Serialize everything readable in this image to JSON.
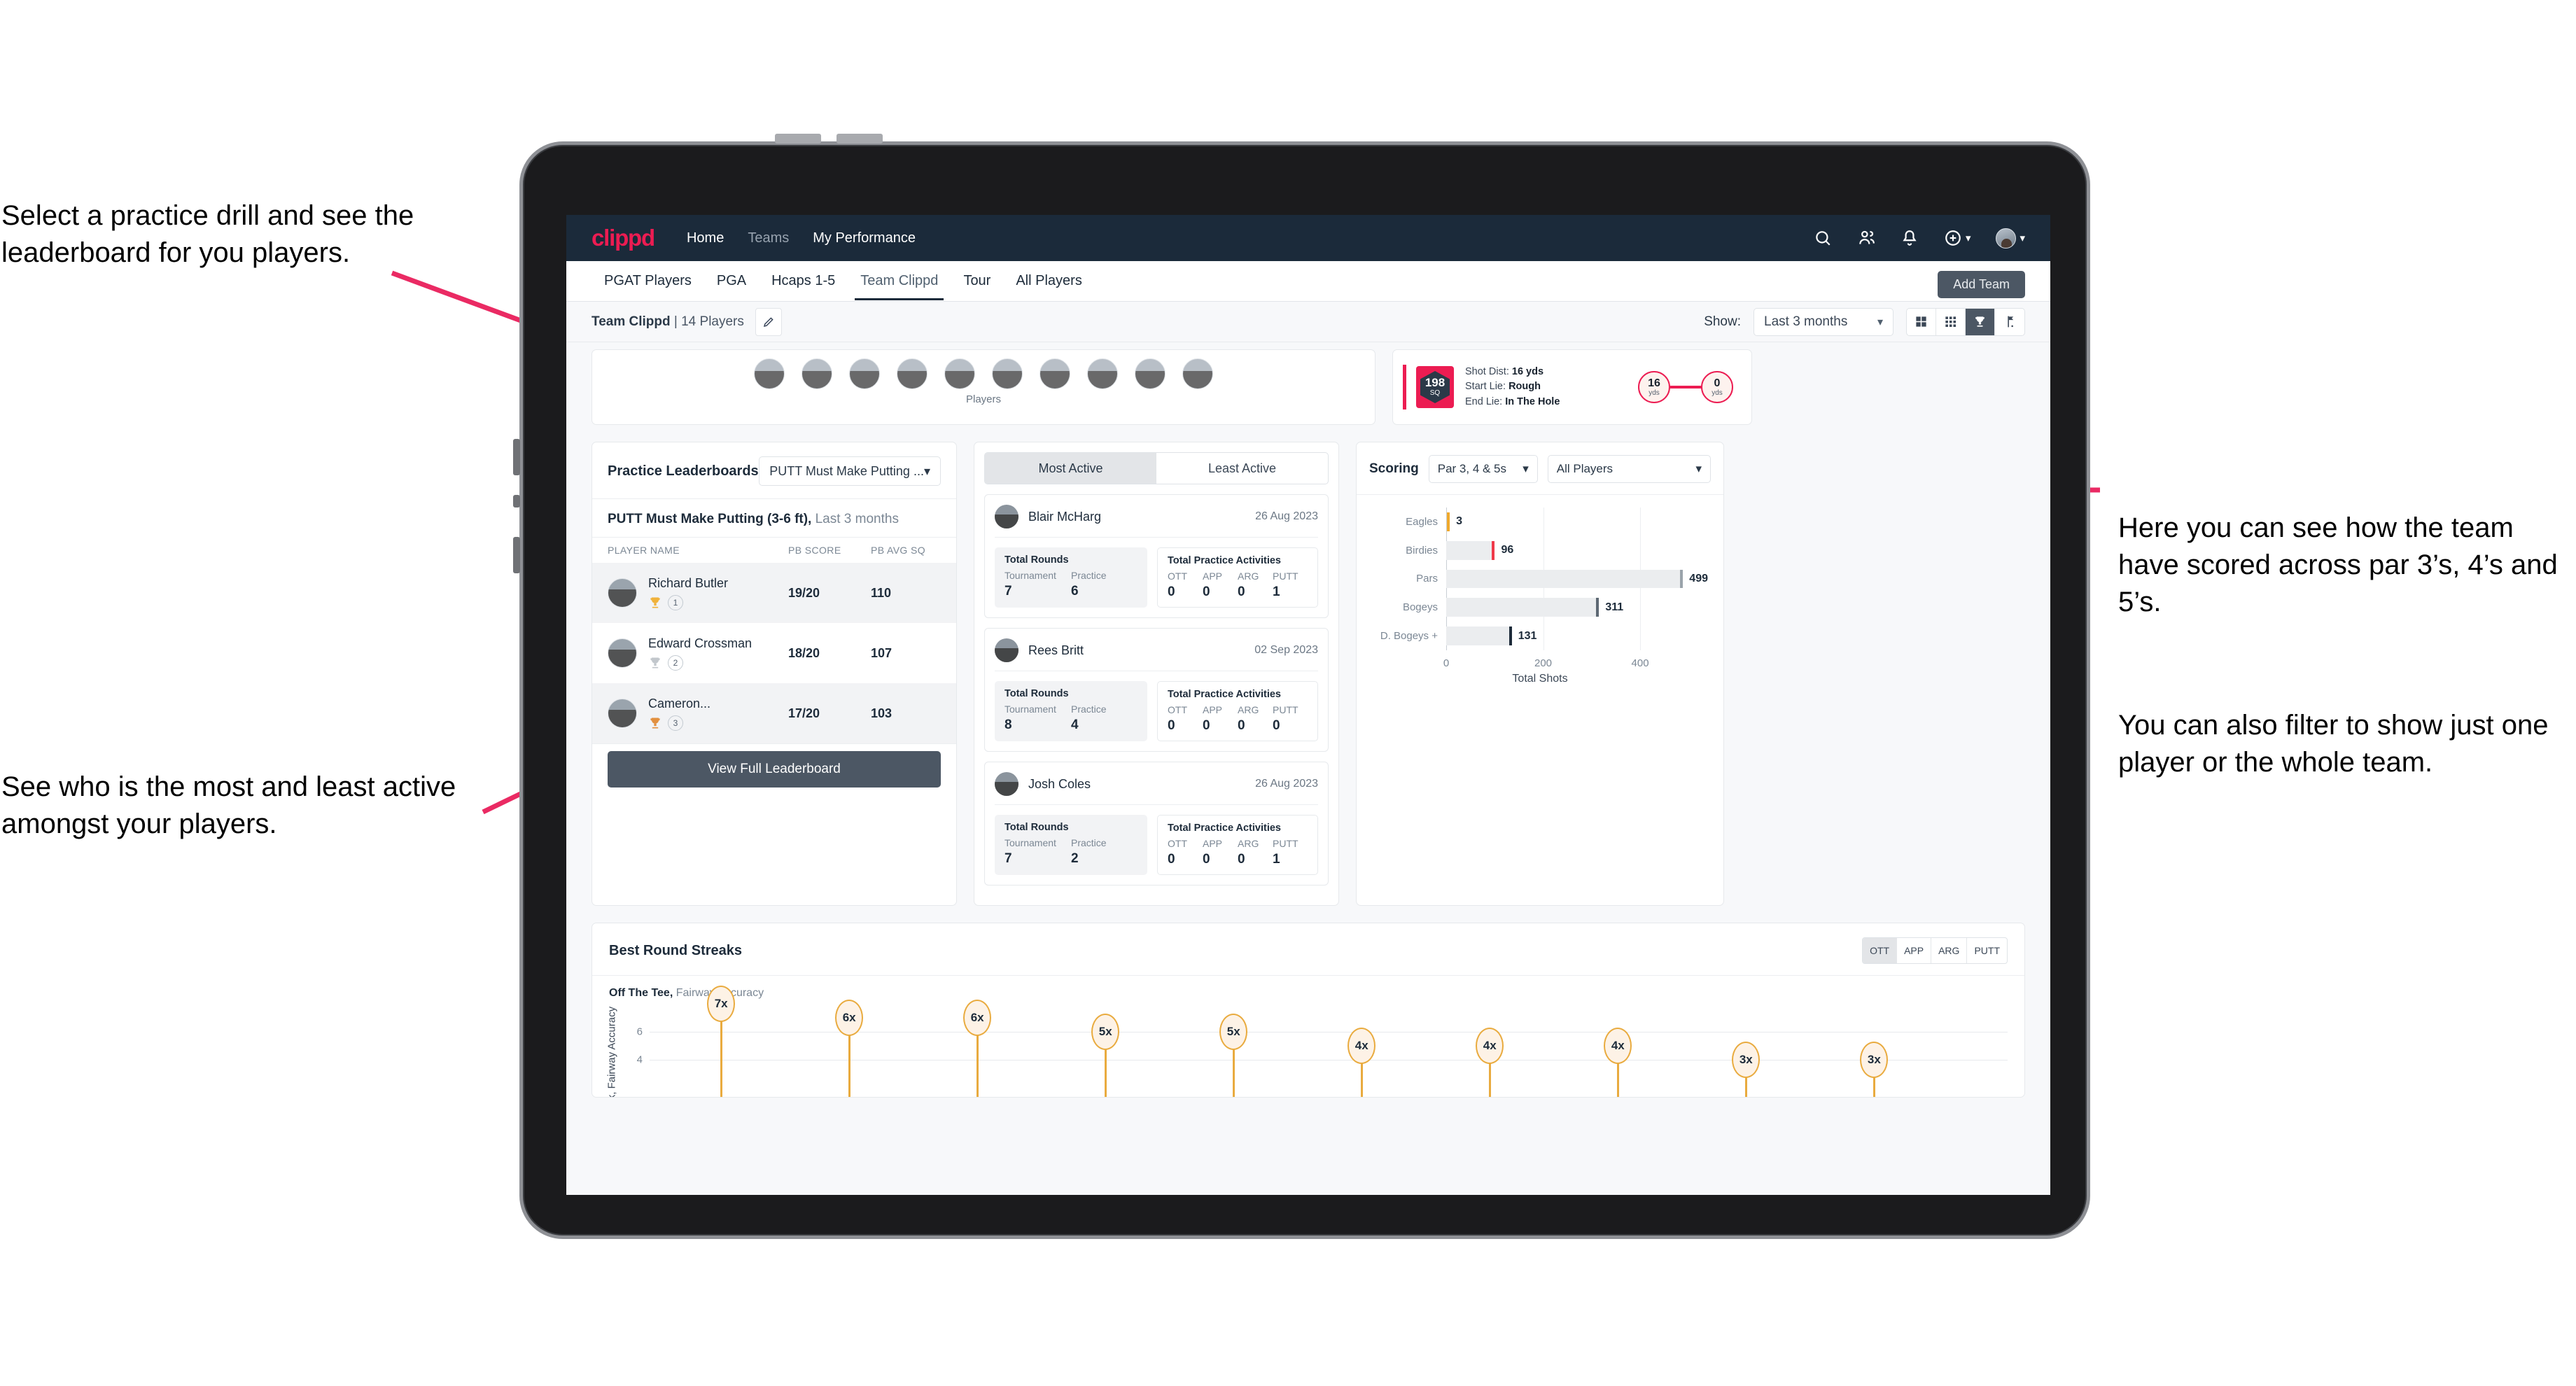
{
  "annotations": {
    "a": "Select a practice drill and see the leaderboard for you players.",
    "b": "See who is the most and least active amongst your players.",
    "c": "Here you can see how the team have scored across par 3’s, 4’s and 5’s.",
    "d": "You can also filter to show just one player or the whole team."
  },
  "colors": {
    "brand_pink": "#ec1c52",
    "nav_dark": "#1b2a3a",
    "button_slate": "#4c5764",
    "gold": "#e9ab3f",
    "bar_grey": "#ebedef"
  },
  "topnav": {
    "logo": "clippd",
    "links": [
      {
        "label": "Home",
        "active": true
      },
      {
        "label": "Teams",
        "active": false
      },
      {
        "label": "My Performance",
        "active": true
      }
    ],
    "icons": [
      "search-icon",
      "people-icon",
      "notification-bell-icon",
      "add-circle-icon",
      "avatar"
    ]
  },
  "tabs": [
    {
      "label": "PGAT Players",
      "state": "normal"
    },
    {
      "label": "PGA",
      "state": "normal"
    },
    {
      "label": "Hcaps 1-5",
      "state": "normal"
    },
    {
      "label": "Team Clippd",
      "state": "active"
    },
    {
      "label": "Tour",
      "state": "normal"
    },
    {
      "label": "All Players",
      "state": "normal"
    }
  ],
  "add_team_button": "Add Team",
  "subheader": {
    "team_label_bold": "Team Clippd",
    "team_label_rest": " | 14 Players",
    "show_label": "Show:",
    "range_value": "Last 3 months",
    "view_buttons": [
      "grid-large-icon",
      "grid-small-icon",
      "trophy-icon",
      "flag-icon"
    ],
    "active_view": "trophy-icon"
  },
  "players_strip": {
    "caption": "Players",
    "count": 10
  },
  "shot_card": {
    "badge_value": "198",
    "badge_unit": "SQ",
    "rows": [
      {
        "label": "Shot Dist:",
        "value": "16 yds"
      },
      {
        "label": "Start Lie:",
        "value": "Rough"
      },
      {
        "label": "End Lie:",
        "value": "In The Hole"
      }
    ],
    "start_distance": "16",
    "start_unit": "yds",
    "end_distance": "0",
    "end_unit": "yds"
  },
  "leaderboard": {
    "title": "Practice Leaderboards",
    "drill_select": "PUTT Must Make Putting ...",
    "subtitle_bold": "PUTT Must Make Putting (3-6 ft),",
    "subtitle_rest": " Last 3 months",
    "columns": [
      "PLAYER NAME",
      "PB SCORE",
      "PB AVG SQ"
    ],
    "rows": [
      {
        "name": "Richard Butler",
        "rank": "1",
        "medal": "gold",
        "score": "19/20",
        "sq": "110"
      },
      {
        "name": "Edward Crossman",
        "rank": "2",
        "medal": "silver",
        "score": "18/20",
        "sq": "107"
      },
      {
        "name": "Cameron...",
        "rank": "3",
        "medal": "bronze",
        "score": "17/20",
        "sq": "103"
      }
    ],
    "button": "View Full Leaderboard"
  },
  "activity": {
    "tabs": [
      {
        "label": "Most Active",
        "active": true
      },
      {
        "label": "Least Active",
        "active": false
      }
    ],
    "stat_titles": {
      "rounds": "Total Rounds",
      "practice": "Total Practice Activities"
    },
    "rounds_labels": [
      "Tournament",
      "Practice"
    ],
    "practice_labels": [
      "OTT",
      "APP",
      "ARG",
      "PUTT"
    ],
    "players": [
      {
        "name": "Blair McHarg",
        "date": "26 Aug 2023",
        "rounds": [
          "7",
          "6"
        ],
        "practice": [
          "0",
          "0",
          "0",
          "1"
        ]
      },
      {
        "name": "Rees Britt",
        "date": "02 Sep 2023",
        "rounds": [
          "8",
          "4"
        ],
        "practice": [
          "0",
          "0",
          "0",
          "0"
        ]
      },
      {
        "name": "Josh Coles",
        "date": "26 Aug 2023",
        "rounds": [
          "7",
          "2"
        ],
        "practice": [
          "0",
          "0",
          "0",
          "1"
        ]
      }
    ]
  },
  "scoring": {
    "title": "Scoring",
    "par_select": "Par 3, 4 & 5s",
    "player_select": "All Players"
  },
  "streaks": {
    "title": "Best Round Streaks",
    "segments": [
      {
        "label": "OTT",
        "active": true
      },
      {
        "label": "APP",
        "active": false
      },
      {
        "label": "ARG",
        "active": false
      },
      {
        "label": "PUTT",
        "active": false
      }
    ],
    "subtitle_bold": "Off The Tee,",
    "subtitle_rest": " Fairway Accuracy"
  },
  "chart_data": [
    {
      "type": "bar",
      "orientation": "horizontal",
      "title": "Scoring",
      "categories": [
        "Eagles",
        "Birdies",
        "Pars",
        "Bogeys",
        "D. Bogeys +"
      ],
      "values": [
        3,
        96,
        499,
        311,
        131
      ],
      "cap_colors": [
        "#f0a92c",
        "#ef3a4a",
        "#9aa3ab",
        "#5d6873",
        "#1d2b3a"
      ],
      "xlabel": "Total Shots",
      "ylabel": "",
      "xticks": [
        0,
        200,
        400
      ],
      "xlim": [
        0,
        540
      ],
      "grid": true,
      "legend": "none"
    },
    {
      "type": "bar",
      "orientation": "vertical-lollipop",
      "title": "Best Round Streaks",
      "subtitle": "Off The Tee, Fairway Accuracy",
      "ylabel": "Streak, Fairway Accuracy",
      "yticks": [
        4,
        6
      ],
      "ylim": [
        0,
        8
      ],
      "categories": [
        "1",
        "2",
        "3",
        "4",
        "5",
        "6",
        "7",
        "8",
        "9",
        "10"
      ],
      "values": [
        7,
        6,
        6,
        5,
        5,
        4,
        4,
        4,
        3,
        3
      ],
      "value_labels": [
        "7x",
        "6x",
        "6x",
        "5x",
        "5x",
        "4x",
        "4x",
        "4x",
        "3x",
        "3x"
      ],
      "grid": true,
      "legend": "none"
    }
  ]
}
